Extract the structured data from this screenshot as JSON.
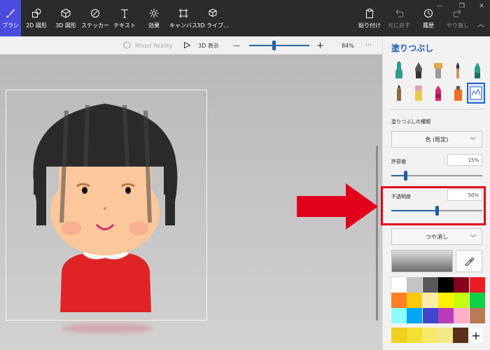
{
  "toolbar": {
    "tools": [
      {
        "id": "brush",
        "label": "ブラシ",
        "icon": "brush-icon"
      },
      {
        "id": "2d-shapes",
        "label": "2D 図形",
        "icon": "2d-shapes-icon"
      },
      {
        "id": "3d-shapes",
        "label": "3D 図形",
        "icon": "3d-shapes-icon"
      },
      {
        "id": "stickers",
        "label": "ステッカー",
        "icon": "sticker-icon"
      },
      {
        "id": "text",
        "label": "テキスト",
        "icon": "text-icon"
      },
      {
        "id": "effects",
        "label": "効果",
        "icon": "effects-icon"
      },
      {
        "id": "canvas",
        "label": "キャンバス",
        "icon": "canvas-icon"
      },
      {
        "id": "3d-library",
        "label": "3D ライブ...",
        "icon": "3d-library-icon"
      }
    ],
    "paste_label": "貼り付け",
    "undo_label": "元に戻す",
    "history_label": "履歴",
    "redo_label": "やり直し"
  },
  "subbar": {
    "mixed_reality_label": "Mixed Reality",
    "view3d_label": "3D 表示",
    "zoom_minus": "—",
    "zoom_plus": "+",
    "zoom_level": "84%",
    "zoom_fraction": 0.41,
    "more_label": "···"
  },
  "panel": {
    "title": "塗りつぶし",
    "fill_type_label": "塗りつぶしの種類",
    "fill_type_value": "色 (既定)",
    "tolerance_label": "許容値",
    "tolerance_value": "15%",
    "tolerance_fraction": 0.15,
    "opacity_label": "不透明度",
    "opacity_value": "50%",
    "opacity_fraction": 0.5,
    "finish_value": "つや消し",
    "add_color_label": "+"
  },
  "brushes": [
    {
      "name": "marker",
      "color": "#2a9d8f"
    },
    {
      "name": "calligraphy-pen",
      "color": "#555555"
    },
    {
      "name": "oil-brush",
      "color": "#e0a84a"
    },
    {
      "name": "watercolor",
      "color": "#555555"
    },
    {
      "name": "pixel-pen",
      "color": "#2a9d8f"
    },
    {
      "name": "pencil",
      "color": "#8a6a3a"
    },
    {
      "name": "eraser",
      "color": "#e8a0b0"
    },
    {
      "name": "crayon",
      "color": "#d8266a"
    },
    {
      "name": "spray-can",
      "color": "#f07020"
    },
    {
      "name": "fill",
      "color": "#1f5fc6"
    }
  ],
  "palette": [
    "#ffffff",
    "#c3c3c3",
    "#585858",
    "#000000",
    "#88001b",
    "#ec1c24",
    "#ff7f27",
    "#ffc90e",
    "#fdeca6",
    "#fff200",
    "#c4ff0e",
    "#0ed145",
    "#8cfffb",
    "#00a8f3",
    "#3f48cc",
    "#b83dba",
    "#ffaec8",
    "#b97a56"
  ],
  "custom_colors": [
    "#f0d020",
    "#f3e030",
    "#f5ea6a",
    "#f0ea8a",
    "#5a3018"
  ],
  "colors": {
    "accent": "#1f5fc6",
    "highlight": "#e3001b",
    "ribbon": "#2b2b2b",
    "brush_active": "#4a4ce0"
  }
}
